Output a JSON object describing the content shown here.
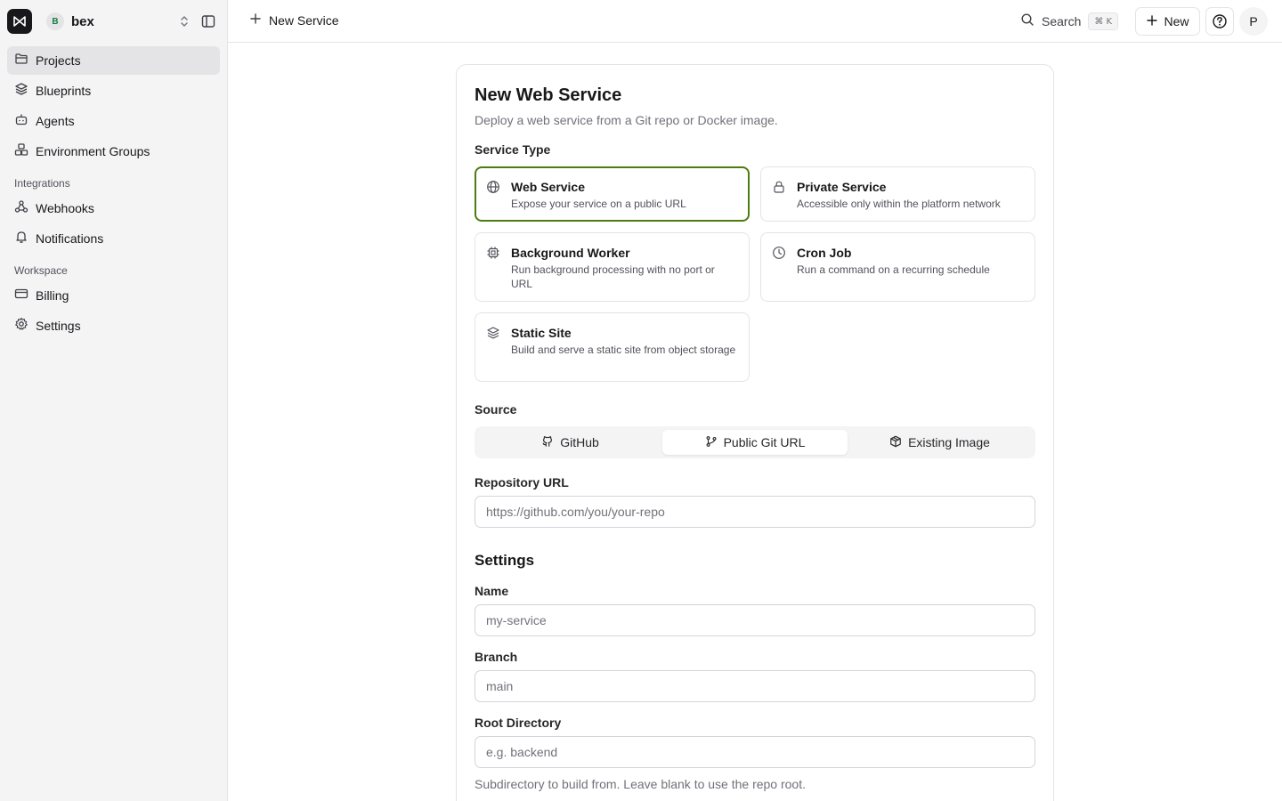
{
  "workspace": {
    "initial": "B",
    "name": "bex"
  },
  "sidebar": {
    "items": [
      {
        "label": "Projects",
        "icon": "folder-icon"
      },
      {
        "label": "Blueprints",
        "icon": "layers-icon"
      },
      {
        "label": "Agents",
        "icon": "bot-icon"
      },
      {
        "label": "Environment Groups",
        "icon": "boxes-icon"
      }
    ],
    "integrations_label": "Integrations",
    "integrations": [
      {
        "label": "Webhooks",
        "icon": "webhook-icon"
      },
      {
        "label": "Notifications",
        "icon": "bell-icon"
      }
    ],
    "workspace_label": "Workspace",
    "workspace_items": [
      {
        "label": "Billing",
        "icon": "credit-card-icon"
      },
      {
        "label": "Settings",
        "icon": "gear-icon"
      }
    ]
  },
  "topbar": {
    "breadcrumb": "New Service",
    "search_label": "Search",
    "search_shortcut": "⌘ K",
    "new_label": "New",
    "user_initial": "P"
  },
  "form": {
    "title": "New Web Service",
    "subtitle": "Deploy a web service from a Git repo or Docker image.",
    "service_type_label": "Service Type",
    "service_types": [
      {
        "title": "Web Service",
        "desc": "Expose your service on a public URL",
        "icon": "globe-icon",
        "selected": true
      },
      {
        "title": "Private Service",
        "desc": "Accessible only within the platform network",
        "icon": "lock-icon",
        "selected": false
      },
      {
        "title": "Background Worker",
        "desc": "Run background processing with no port or URL",
        "icon": "cpu-icon",
        "selected": false
      },
      {
        "title": "Cron Job",
        "desc": "Run a command on a recurring schedule",
        "icon": "clock-icon",
        "selected": false
      },
      {
        "title": "Static Site",
        "desc": "Build and serve a static site from object storage",
        "icon": "layers-icon",
        "selected": false
      }
    ],
    "source_label": "Source",
    "sources": [
      {
        "label": "GitHub",
        "icon": "github-icon",
        "active": false
      },
      {
        "label": "Public Git URL",
        "icon": "git-branch-icon",
        "active": true
      },
      {
        "label": "Existing Image",
        "icon": "package-icon",
        "active": false
      }
    ],
    "repo_label": "Repository URL",
    "repo_placeholder": "https://github.com/you/your-repo",
    "settings_title": "Settings",
    "name_label": "Name",
    "name_placeholder": "my-service",
    "branch_label": "Branch",
    "branch_placeholder": "main",
    "rootdir_label": "Root Directory",
    "rootdir_placeholder": "e.g. backend",
    "rootdir_hint": "Subdirectory to build from. Leave blank to use the repo root."
  },
  "colors": {
    "accent": "#4d7c0f",
    "sidebar_bg": "#f4f4f5",
    "border": "#e4e4e7"
  }
}
